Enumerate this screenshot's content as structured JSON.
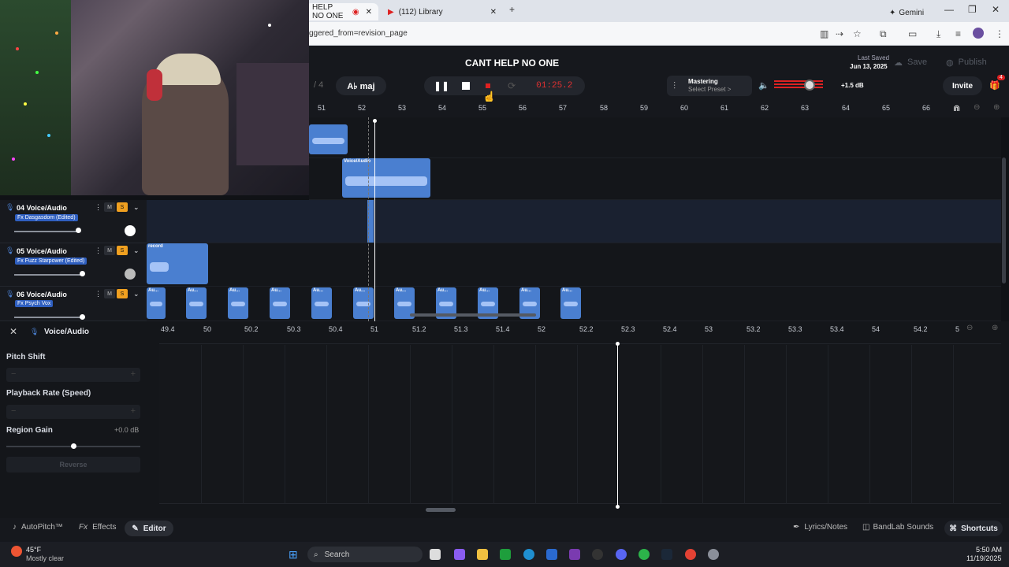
{
  "browser": {
    "tabs": [
      "HELP NO ONE",
      "(112) Library"
    ],
    "new_tab": "+",
    "gemini": "Gemini",
    "address": "ggered_from=revision_page"
  },
  "app": {
    "title": "CANT HELP NO ONE",
    "last_saved_label": "Last Saved",
    "last_saved_date": "Jun 13, 2025",
    "save": "Save",
    "publish": "Publish",
    "invite": "Invite",
    "notif_count": "4",
    "page_frag": "/ 4",
    "key": "A♭ maj",
    "time": "01:25.2",
    "mastering": "Mastering",
    "select_preset": "Select Preset >",
    "volume_db": "+1.5 dB"
  },
  "ruler": [
    "51",
    "52",
    "53",
    "54",
    "55",
    "56",
    "57",
    "58",
    "59",
    "60",
    "61",
    "62",
    "63",
    "64",
    "65",
    "66"
  ],
  "tracks": [
    {
      "name": "04 Voice/Audio",
      "fx": "Fx Dasgasdom (Edited)",
      "m": "M",
      "s": "S"
    },
    {
      "name": "05 Voice/Audio",
      "fx": "Fx Fuzz Starpower (Edited)",
      "m": "M",
      "s": "S"
    },
    {
      "name": "06 Voice/Audio",
      "fx": "Fx Psych Vox",
      "m": "M",
      "s": "S"
    }
  ],
  "clip_labels": {
    "voice": "Voice/Audio",
    "record": "record",
    "au": "Au..."
  },
  "editor": {
    "title": "Voice/Audio",
    "pitch_shift": "Pitch Shift",
    "playback_rate": "Playback Rate (Speed)",
    "region_gain": "Region Gain",
    "region_gain_value": "+0.0 dB",
    "reverse": "Reverse",
    "minus": "−",
    "plus": "+",
    "ruler": [
      "49.4",
      "50",
      "50.2",
      "50.3",
      "50.4",
      "51",
      "51.2",
      "51.3",
      "51.4",
      "52",
      "52.2",
      "52.3",
      "52.4",
      "53",
      "53.2",
      "53.3",
      "53.4",
      "54",
      "54.2",
      "5"
    ]
  },
  "footer": {
    "autopitch": "AutoPitch™",
    "effects": "Effects",
    "editor": "Editor",
    "lyrics": "Lyrics/Notes",
    "sounds": "BandLab Sounds",
    "shortcuts": "Shortcuts"
  },
  "taskbar": {
    "temp": "45°F",
    "weather": "Mostly clear",
    "search": "Search",
    "time": "5:50 AM",
    "date": "11/19/2025"
  },
  "colors": {
    "accent": "#4a7fd0",
    "record": "#e02020",
    "solo": "#f0a020"
  }
}
